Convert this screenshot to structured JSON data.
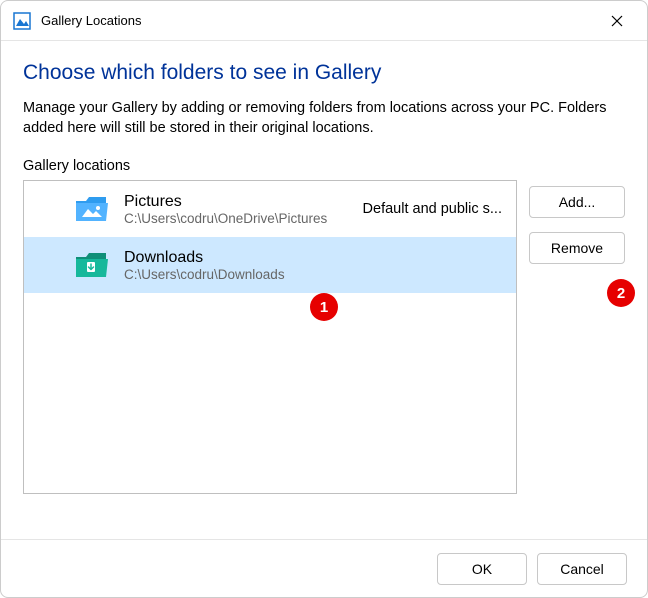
{
  "titlebar": {
    "title": "Gallery Locations"
  },
  "heading": "Choose which folders to see in Gallery",
  "subtext": "Manage your Gallery by adding or removing folders from locations across your PC. Folders added here will still be stored in their original locations.",
  "section_label": "Gallery locations",
  "locations": [
    {
      "name": "Pictures",
      "path": "C:\\Users\\codru\\OneDrive\\Pictures",
      "tag": "Default and public s...",
      "selected": false,
      "icon": "pictures"
    },
    {
      "name": "Downloads",
      "path": "C:\\Users\\codru\\Downloads",
      "tag": "",
      "selected": true,
      "icon": "downloads"
    }
  ],
  "buttons": {
    "add": "Add...",
    "remove": "Remove",
    "ok": "OK",
    "cancel": "Cancel"
  },
  "annotations": {
    "a1": "1",
    "a2": "2"
  }
}
